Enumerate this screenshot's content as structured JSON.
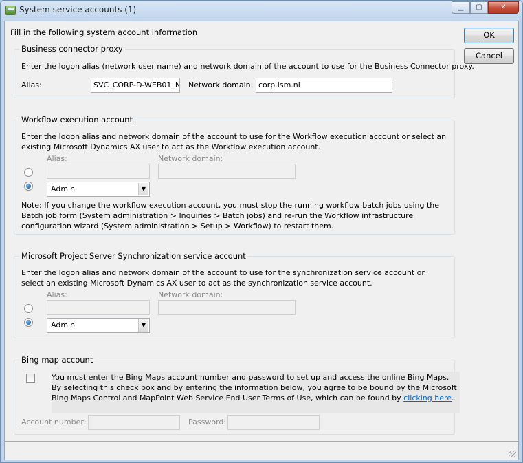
{
  "window": {
    "title": "System service accounts (1)",
    "controls": {
      "minimize": "▁",
      "maximize": "▢",
      "close": "✕"
    }
  },
  "intro": "Fill in the following system account information",
  "buttons": {
    "ok_label": "OK",
    "cancel_label": "Cancel"
  },
  "business_connector": {
    "legend": "Business connector proxy",
    "description": "Enter the logon alias (network user name) and network domain of the account to use for the Business Connector proxy.",
    "alias_label": "Alias:",
    "alias_value": "SVC_CORP-D-WEB01_N",
    "domain_label": "Network domain:",
    "domain_value": "corp.ism.nl"
  },
  "workflow": {
    "legend": "Workflow execution account",
    "description": "Enter the logon alias and network domain of the account to use for the Workflow execution account or select an existing Microsoft Dynamics AX user to act as the Workflow execution account.",
    "alias_label": "Alias:",
    "domain_label": "Network domain:",
    "user_value": "Admin",
    "note": "Note: If you change the workflow execution account, you must stop the running workflow batch jobs using the Batch job form (System administration > Inquiries > Batch jobs) and re-run the Workflow infrastructure configuration wizard (System administration > Setup > Workflow) to restart them."
  },
  "project_server": {
    "legend": "Microsoft Project Server Synchronization service account",
    "description": "Enter the logon alias and network domain of the account to use for the synchronization service account or select an existing Microsoft Dynamics AX user to act as the  synchronization service account.",
    "alias_label": "Alias:",
    "domain_label": "Network domain:",
    "user_value": "Admin"
  },
  "bing": {
    "legend": "Bing map account",
    "agreement_text": "You must enter the Bing Maps account number and password to set up and access the online Bing Maps. By selecting this check box and by entering the information below, you agree to be bound by the Microsoft Bing Maps Control and MapPoint Web Service End User Terms of Use, which can be found by ",
    "link_text": "clicking here",
    "agreement_end": ".",
    "account_label": "Account number:",
    "password_label": "Password:"
  }
}
